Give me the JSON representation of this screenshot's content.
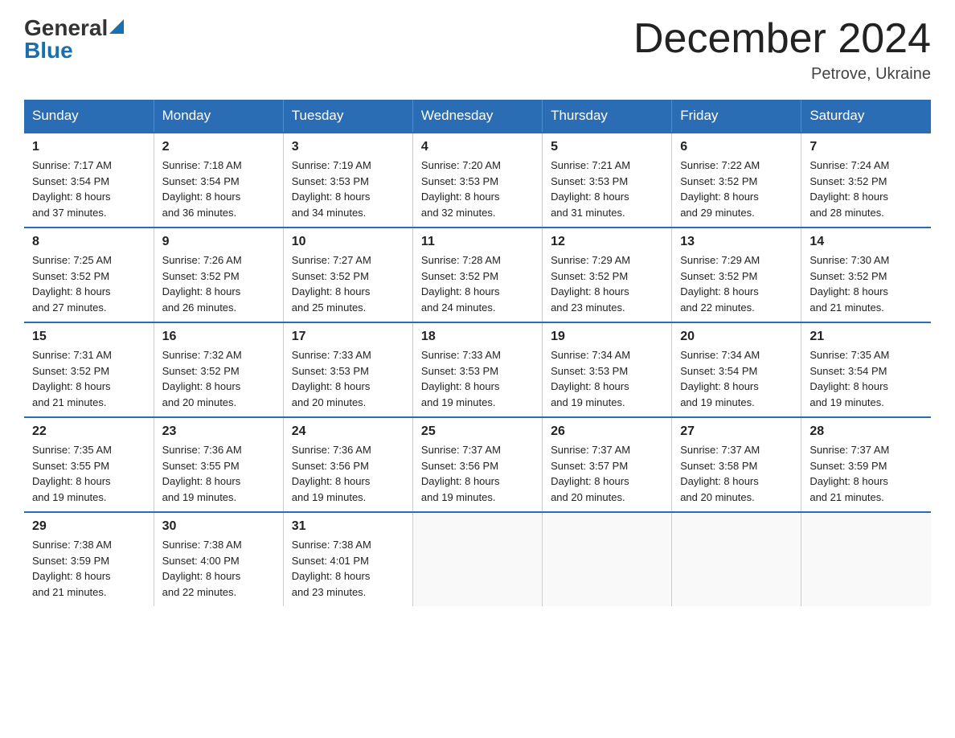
{
  "logo": {
    "general": "General",
    "triangle": "▶",
    "blue": "Blue"
  },
  "header": {
    "month_year": "December 2024",
    "location": "Petrove, Ukraine"
  },
  "weekdays": [
    "Sunday",
    "Monday",
    "Tuesday",
    "Wednesday",
    "Thursday",
    "Friday",
    "Saturday"
  ],
  "weeks": [
    [
      {
        "day": "1",
        "sunrise": "7:17 AM",
        "sunset": "3:54 PM",
        "daylight": "8 hours and 37 minutes."
      },
      {
        "day": "2",
        "sunrise": "7:18 AM",
        "sunset": "3:54 PM",
        "daylight": "8 hours and 36 minutes."
      },
      {
        "day": "3",
        "sunrise": "7:19 AM",
        "sunset": "3:53 PM",
        "daylight": "8 hours and 34 minutes."
      },
      {
        "day": "4",
        "sunrise": "7:20 AM",
        "sunset": "3:53 PM",
        "daylight": "8 hours and 32 minutes."
      },
      {
        "day": "5",
        "sunrise": "7:21 AM",
        "sunset": "3:53 PM",
        "daylight": "8 hours and 31 minutes."
      },
      {
        "day": "6",
        "sunrise": "7:22 AM",
        "sunset": "3:52 PM",
        "daylight": "8 hours and 29 minutes."
      },
      {
        "day": "7",
        "sunrise": "7:24 AM",
        "sunset": "3:52 PM",
        "daylight": "8 hours and 28 minutes."
      }
    ],
    [
      {
        "day": "8",
        "sunrise": "7:25 AM",
        "sunset": "3:52 PM",
        "daylight": "8 hours and 27 minutes."
      },
      {
        "day": "9",
        "sunrise": "7:26 AM",
        "sunset": "3:52 PM",
        "daylight": "8 hours and 26 minutes."
      },
      {
        "day": "10",
        "sunrise": "7:27 AM",
        "sunset": "3:52 PM",
        "daylight": "8 hours and 25 minutes."
      },
      {
        "day": "11",
        "sunrise": "7:28 AM",
        "sunset": "3:52 PM",
        "daylight": "8 hours and 24 minutes."
      },
      {
        "day": "12",
        "sunrise": "7:29 AM",
        "sunset": "3:52 PM",
        "daylight": "8 hours and 23 minutes."
      },
      {
        "day": "13",
        "sunrise": "7:29 AM",
        "sunset": "3:52 PM",
        "daylight": "8 hours and 22 minutes."
      },
      {
        "day": "14",
        "sunrise": "7:30 AM",
        "sunset": "3:52 PM",
        "daylight": "8 hours and 21 minutes."
      }
    ],
    [
      {
        "day": "15",
        "sunrise": "7:31 AM",
        "sunset": "3:52 PM",
        "daylight": "8 hours and 21 minutes."
      },
      {
        "day": "16",
        "sunrise": "7:32 AM",
        "sunset": "3:52 PM",
        "daylight": "8 hours and 20 minutes."
      },
      {
        "day": "17",
        "sunrise": "7:33 AM",
        "sunset": "3:53 PM",
        "daylight": "8 hours and 20 minutes."
      },
      {
        "day": "18",
        "sunrise": "7:33 AM",
        "sunset": "3:53 PM",
        "daylight": "8 hours and 19 minutes."
      },
      {
        "day": "19",
        "sunrise": "7:34 AM",
        "sunset": "3:53 PM",
        "daylight": "8 hours and 19 minutes."
      },
      {
        "day": "20",
        "sunrise": "7:34 AM",
        "sunset": "3:54 PM",
        "daylight": "8 hours and 19 minutes."
      },
      {
        "day": "21",
        "sunrise": "7:35 AM",
        "sunset": "3:54 PM",
        "daylight": "8 hours and 19 minutes."
      }
    ],
    [
      {
        "day": "22",
        "sunrise": "7:35 AM",
        "sunset": "3:55 PM",
        "daylight": "8 hours and 19 minutes."
      },
      {
        "day": "23",
        "sunrise": "7:36 AM",
        "sunset": "3:55 PM",
        "daylight": "8 hours and 19 minutes."
      },
      {
        "day": "24",
        "sunrise": "7:36 AM",
        "sunset": "3:56 PM",
        "daylight": "8 hours and 19 minutes."
      },
      {
        "day": "25",
        "sunrise": "7:37 AM",
        "sunset": "3:56 PM",
        "daylight": "8 hours and 19 minutes."
      },
      {
        "day": "26",
        "sunrise": "7:37 AM",
        "sunset": "3:57 PM",
        "daylight": "8 hours and 20 minutes."
      },
      {
        "day": "27",
        "sunrise": "7:37 AM",
        "sunset": "3:58 PM",
        "daylight": "8 hours and 20 minutes."
      },
      {
        "day": "28",
        "sunrise": "7:37 AM",
        "sunset": "3:59 PM",
        "daylight": "8 hours and 21 minutes."
      }
    ],
    [
      {
        "day": "29",
        "sunrise": "7:38 AM",
        "sunset": "3:59 PM",
        "daylight": "8 hours and 21 minutes."
      },
      {
        "day": "30",
        "sunrise": "7:38 AM",
        "sunset": "4:00 PM",
        "daylight": "8 hours and 22 minutes."
      },
      {
        "day": "31",
        "sunrise": "7:38 AM",
        "sunset": "4:01 PM",
        "daylight": "8 hours and 23 minutes."
      },
      null,
      null,
      null,
      null
    ]
  ],
  "labels": {
    "sunrise": "Sunrise:",
    "sunset": "Sunset:",
    "daylight": "Daylight:"
  }
}
